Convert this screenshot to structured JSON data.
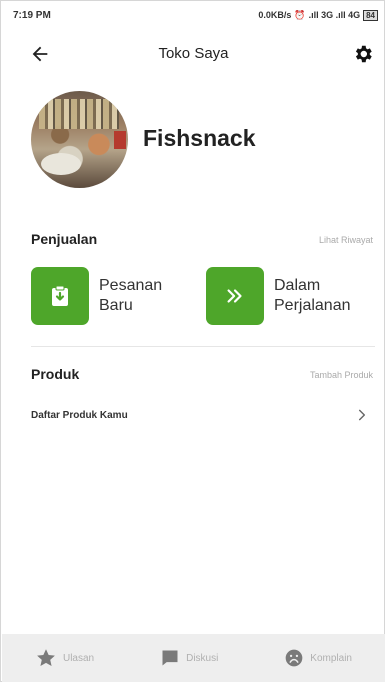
{
  "status_bar": {
    "time": "7:19 PM",
    "speed": "0.0KB/s",
    "network": ".ıll 3G .ıll 4G",
    "battery": "84"
  },
  "app_bar": {
    "title": "Toko Saya"
  },
  "shop": {
    "name": "Fishsnack"
  },
  "sales": {
    "title": "Penjualan",
    "link": "Lihat Riwayat",
    "new_orders": "Pesanan Baru",
    "in_transit": "Dalam Perjalanan"
  },
  "products": {
    "title": "Produk",
    "link": "Tambah Produk",
    "list_item": "Daftar Produk Kamu"
  },
  "bottom_nav": {
    "reviews": "Ulasan",
    "discussion": "Diskusi",
    "complaints": "Komplain"
  },
  "colors": {
    "accent_green": "#4ea62a",
    "icon_grey": "#7a7a7a"
  },
  "icons": {
    "back": "arrow-left-icon",
    "settings": "gear-icon",
    "new_orders": "clipboard-download-icon",
    "in_transit": "double-chevron-right-icon",
    "list_chevron": "chevron-right-icon",
    "reviews": "star-icon",
    "discussion": "chat-bubble-icon",
    "complaints": "sad-face-icon"
  }
}
